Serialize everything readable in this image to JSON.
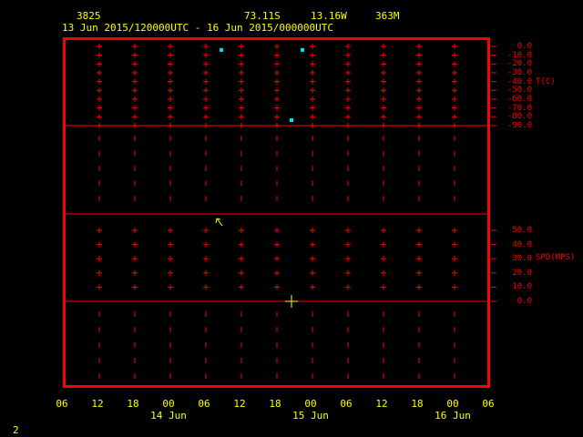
{
  "header": {
    "station_id": "3825",
    "latitude": "73.11S",
    "longitude": "13.16W",
    "elevation": "363M",
    "time_range": "13 Jun 2015/120000UTC - 16 Jun 2015/000000UTC"
  },
  "temperature_panel": {
    "label": "T(C)",
    "tick_labels": [
      "0.0",
      "-10.0",
      "-20.0",
      "-30.0",
      "-40.0",
      "-50.0",
      "-60.0",
      "-70.0",
      "-80.0",
      "-90.0"
    ],
    "points_c": [
      -4,
      -4,
      -84
    ]
  },
  "speed_panel": {
    "label": "SPD(MPS)",
    "tick_labels": [
      "50.0",
      "40.0",
      "30.0",
      "20.0",
      "10.0",
      "0.0"
    ]
  },
  "x_axis": {
    "hour_labels": [
      "06",
      "12",
      "18",
      "00",
      "06",
      "12",
      "18",
      "00",
      "06",
      "12",
      "18",
      "00",
      "06"
    ],
    "day_labels": [
      "14 Jun",
      "15 Jun",
      "16 Jun"
    ]
  },
  "corner_label": "2",
  "colors": {
    "background": "#000000",
    "frame": "#ff0000",
    "text": "#ffff00",
    "data_point": "#00e5ff",
    "cursor": "#ffff00"
  }
}
